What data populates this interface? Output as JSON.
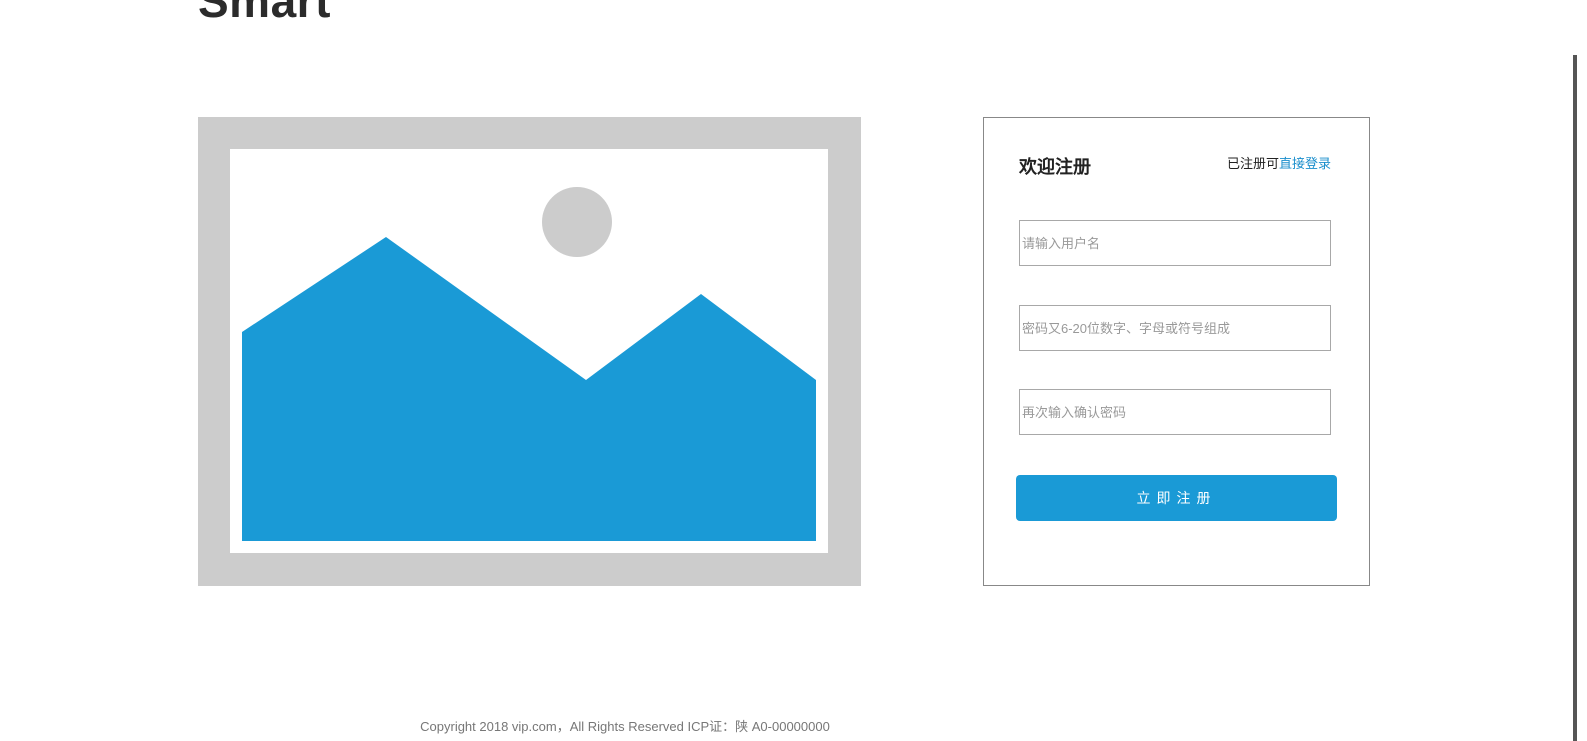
{
  "header": {
    "logo_text": "Smart"
  },
  "hero": {
    "icon": "image-placeholder-icon",
    "frame_color": "#cccccc",
    "mountain_color": "#1a9ad6",
    "sun_color": "#cccccc"
  },
  "register": {
    "title": "欢迎注册",
    "login_prompt": "已注册可",
    "login_link": "直接登录",
    "username_placeholder": "请输入用户名",
    "password_placeholder": "密码又6-20位数字、字母或符号组成",
    "confirm_placeholder": "再次输入确认密码",
    "submit_label": "立即注册"
  },
  "footer": {
    "text": "Copyright 2018 vip.com，All Rights Reserved ICP证：陕 A0-00000000"
  },
  "colors": {
    "accent": "#1a9ad6",
    "link": "#1a8ecc",
    "text": "#222222",
    "muted": "#777777"
  }
}
